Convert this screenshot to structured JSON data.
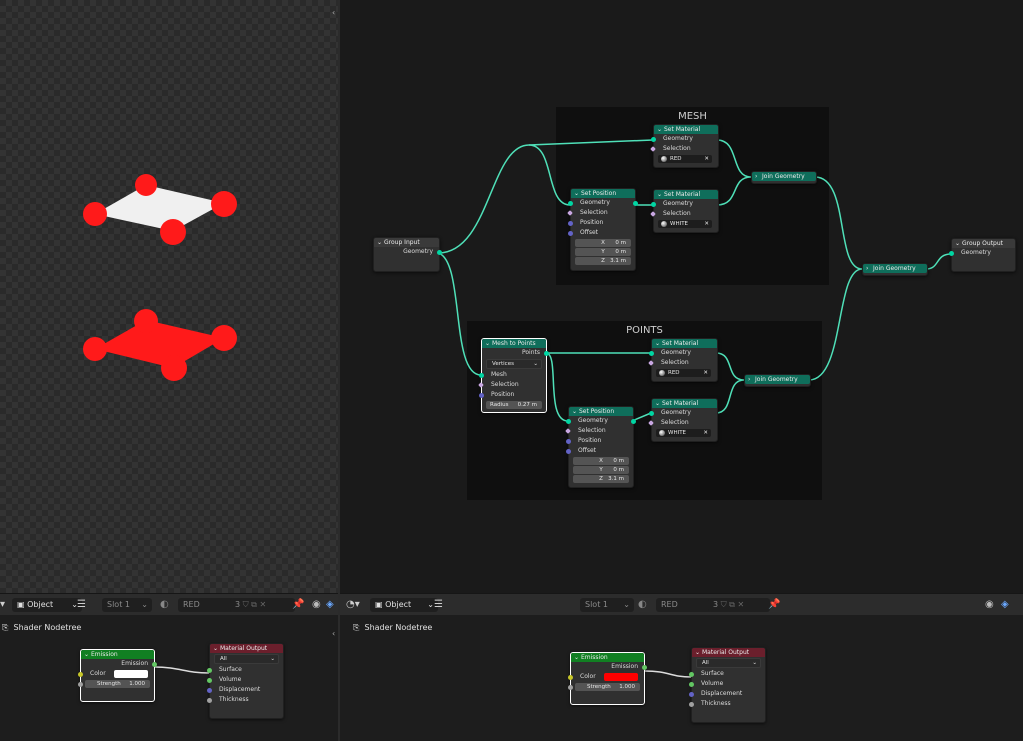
{
  "geometry_nodes": {
    "frames": {
      "mesh": "MESH",
      "points": "POINTS"
    },
    "group_input": {
      "title": "Group Input",
      "geometry": "Geometry"
    },
    "group_output": {
      "title": "Group Output",
      "geometry": "Geometry"
    },
    "mesh": {
      "set_material_red": {
        "title": "Set Material",
        "geometry": "Geometry",
        "selection": "Selection",
        "material": "RED"
      },
      "set_position": {
        "title": "Set Position",
        "geometry": "Geometry",
        "selection": "Selection",
        "position": "Position",
        "offset": "Offset",
        "x_label": "X",
        "x": "0 m",
        "y_label": "Y",
        "y": "0 m",
        "z_label": "Z",
        "z": "3.1 m"
      },
      "set_material_white": {
        "title": "Set Material",
        "geometry": "Geometry",
        "selection": "Selection",
        "material": "WHITE"
      },
      "join": {
        "title": "Join Geometry"
      }
    },
    "points": {
      "mesh_to_points": {
        "title": "Mesh to Points",
        "points": "Points",
        "mode": "Vertices",
        "mesh": "Mesh",
        "selection": "Selection",
        "position": "Position",
        "radius_label": "Radius",
        "radius": "0.27 m"
      },
      "set_material_red": {
        "title": "Set Material",
        "geometry": "Geometry",
        "selection": "Selection",
        "material": "RED"
      },
      "set_position": {
        "title": "Set Position",
        "geometry": "Geometry",
        "selection": "Selection",
        "position": "Position",
        "offset": "Offset",
        "x_label": "X",
        "x": "0 m",
        "y_label": "Y",
        "y": "0 m",
        "z_label": "Z",
        "z": "3.1 m"
      },
      "set_material_white": {
        "title": "Set Material",
        "geometry": "Geometry",
        "selection": "Selection",
        "material": "WHITE"
      },
      "join": {
        "title": "Join Geometry"
      }
    },
    "final_join": {
      "title": "Join Geometry"
    }
  },
  "left_header": {
    "mode": "Object",
    "slot": "Slot 1",
    "material": "RED",
    "users": "3"
  },
  "right_header": {
    "mode": "Object",
    "slot": "Slot 1",
    "material": "RED",
    "users": "3"
  },
  "left_shader": {
    "breadcrumb": "Shader Nodetree",
    "emission": {
      "title": "Emission",
      "output": "Emission",
      "color": "Color",
      "strength_label": "Strength",
      "strength": "1.000",
      "color_hex": "#ffffff"
    },
    "output": {
      "title": "Material Output",
      "target": "All",
      "surface": "Surface",
      "volume": "Volume",
      "displacement": "Displacement",
      "thickness": "Thickness"
    }
  },
  "right_shader": {
    "breadcrumb": "Shader Nodetree",
    "emission": {
      "title": "Emission",
      "output": "Emission",
      "color": "Color",
      "strength_label": "Strength",
      "strength": "1.000",
      "color_hex": "#ff0000"
    },
    "output": {
      "title": "Material Output",
      "target": "All",
      "surface": "Surface",
      "volume": "Volume",
      "displacement": "Displacement",
      "thickness": "Thickness"
    }
  },
  "colors": {
    "link_geometry": "#4fe0b8",
    "red": "#ff1a1a",
    "white": "#f0f0f0"
  }
}
